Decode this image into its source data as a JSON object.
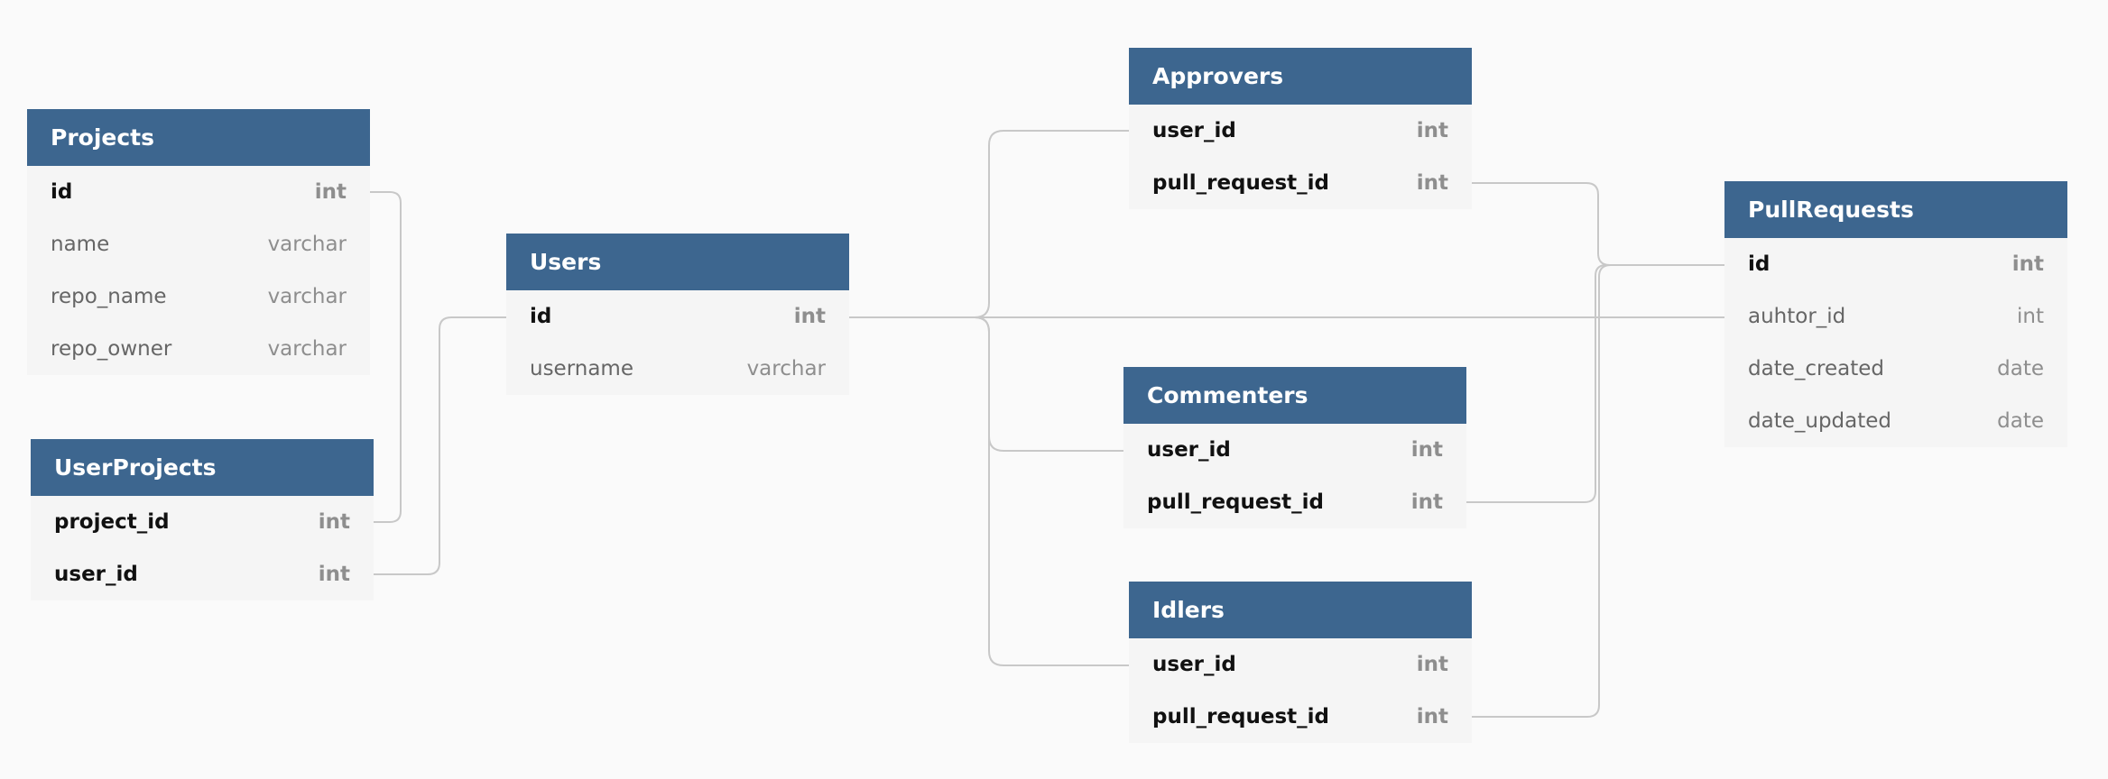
{
  "tables": {
    "projects": {
      "title": "Projects",
      "fields": [
        {
          "name": "id",
          "type": "int",
          "key": true
        },
        {
          "name": "name",
          "type": "varchar",
          "key": false
        },
        {
          "name": "repo_name",
          "type": "varchar",
          "key": false
        },
        {
          "name": "repo_owner",
          "type": "varchar",
          "key": false
        }
      ]
    },
    "userprojects": {
      "title": "UserProjects",
      "fields": [
        {
          "name": "project_id",
          "type": "int",
          "key": true
        },
        {
          "name": "user_id",
          "type": "int",
          "key": true
        }
      ]
    },
    "users": {
      "title": "Users",
      "fields": [
        {
          "name": "id",
          "type": "int",
          "key": true
        },
        {
          "name": "username",
          "type": "varchar",
          "key": false
        }
      ]
    },
    "approvers": {
      "title": "Approvers",
      "fields": [
        {
          "name": "user_id",
          "type": "int",
          "key": true
        },
        {
          "name": "pull_request_id",
          "type": "int",
          "key": true
        }
      ]
    },
    "commenters": {
      "title": "Commenters",
      "fields": [
        {
          "name": "user_id",
          "type": "int",
          "key": true
        },
        {
          "name": "pull_request_id",
          "type": "int",
          "key": true
        }
      ]
    },
    "idlers": {
      "title": "Idlers",
      "fields": [
        {
          "name": "user_id",
          "type": "int",
          "key": true
        },
        {
          "name": "pull_request_id",
          "type": "int",
          "key": true
        }
      ]
    },
    "pullrequests": {
      "title": "PullRequests",
      "fields": [
        {
          "name": "id",
          "type": "int",
          "key": true
        },
        {
          "name": "auhtor_id",
          "type": "int",
          "key": false
        },
        {
          "name": "date_created",
          "type": "date",
          "key": false
        },
        {
          "name": "date_updated",
          "type": "date",
          "key": false
        }
      ]
    }
  },
  "relationships": [
    {
      "from": "userprojects.project_id",
      "to": "projects.id"
    },
    {
      "from": "userprojects.user_id",
      "to": "users.id"
    },
    {
      "from": "approvers.user_id",
      "to": "users.id"
    },
    {
      "from": "commenters.user_id",
      "to": "users.id"
    },
    {
      "from": "idlers.user_id",
      "to": "users.id"
    },
    {
      "from": "pullrequests.auhtor_id",
      "to": "users.id"
    },
    {
      "from": "approvers.pull_request_id",
      "to": "pullrequests.id"
    },
    {
      "from": "commenters.pull_request_id",
      "to": "pullrequests.id"
    },
    {
      "from": "idlers.pull_request_id",
      "to": "pullrequests.id"
    }
  ],
  "colors": {
    "header": "#3d668f",
    "header_text": "#ffffff",
    "table_body": "#f5f5f5",
    "connector": "#c8c8c8",
    "background": "#fafafa"
  }
}
